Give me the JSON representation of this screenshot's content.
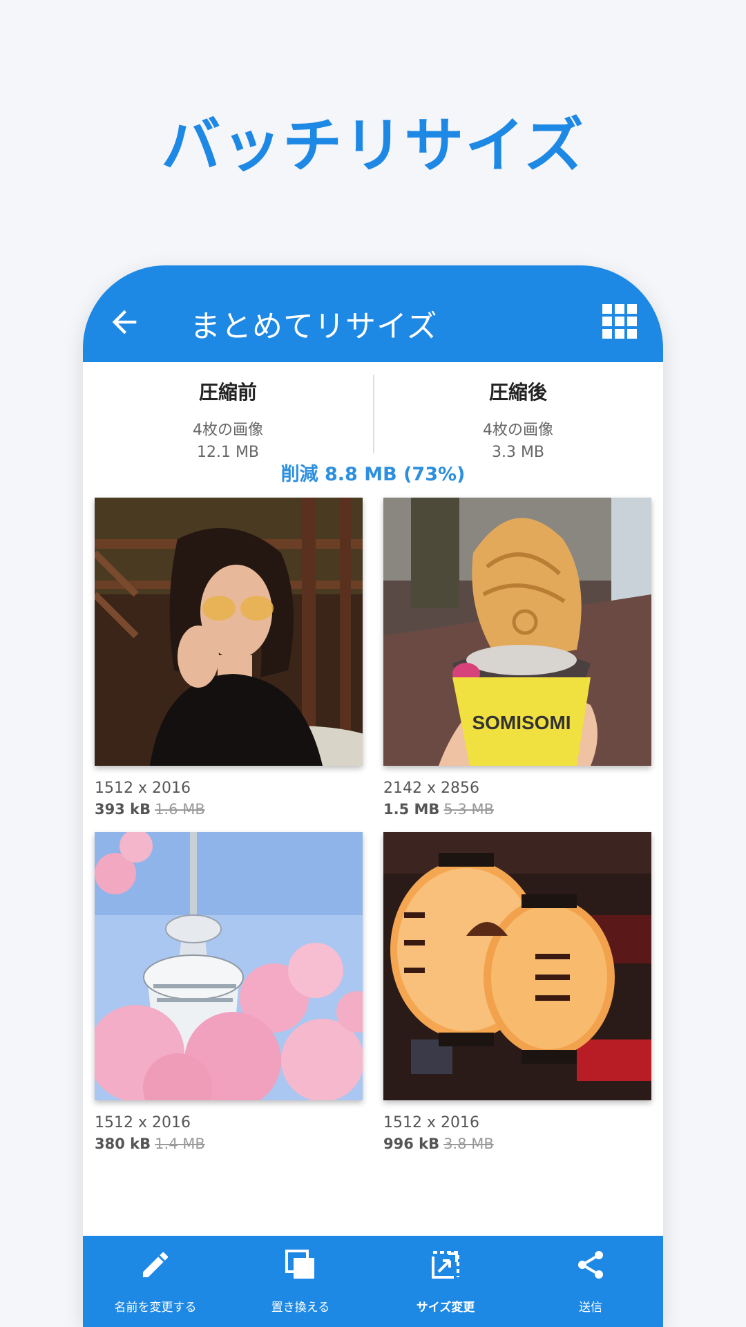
{
  "headline": "バッチリサイズ",
  "appbar": {
    "title": "まとめてリサイズ",
    "back_icon": "arrow-left-icon",
    "grid_icon": "grid-view-icon"
  },
  "summary": {
    "before": {
      "title": "圧縮前",
      "count": "4枚の画像",
      "size": "12.1 MB"
    },
    "after": {
      "title": "圧縮後",
      "count": "4枚の画像",
      "size": "3.3 MB"
    },
    "savings": "削減 8.8 MB (73%)"
  },
  "images": [
    {
      "dims": "1512 x 2016",
      "new_size": "393 kB",
      "old_size": "1.6 MB",
      "subject": "woman with sunglasses"
    },
    {
      "dims": "2142 x 2856",
      "new_size": "1.5 MB",
      "old_size": "5.3 MB",
      "subject": "taiyaki ice cream cone"
    },
    {
      "dims": "1512 x 2016",
      "new_size": "380 kB",
      "old_size": "1.4 MB",
      "subject": "tower with cherry blossoms"
    },
    {
      "dims": "1512 x 2016",
      "new_size": "996 kB",
      "old_size": "3.8 MB",
      "subject": "paper lanterns at night"
    }
  ],
  "bottombar": {
    "items": [
      {
        "label": "名前を変更する",
        "icon": "pencil-icon"
      },
      {
        "label": "置き換える",
        "icon": "copy-icon"
      },
      {
        "label": "サイズ変更",
        "icon": "resize-icon"
      },
      {
        "label": "送信",
        "icon": "share-icon"
      }
    ]
  },
  "colors": {
    "accent": "#1e88e5",
    "savings_text": "#2d8fe0",
    "background": "#f4f6f9"
  }
}
